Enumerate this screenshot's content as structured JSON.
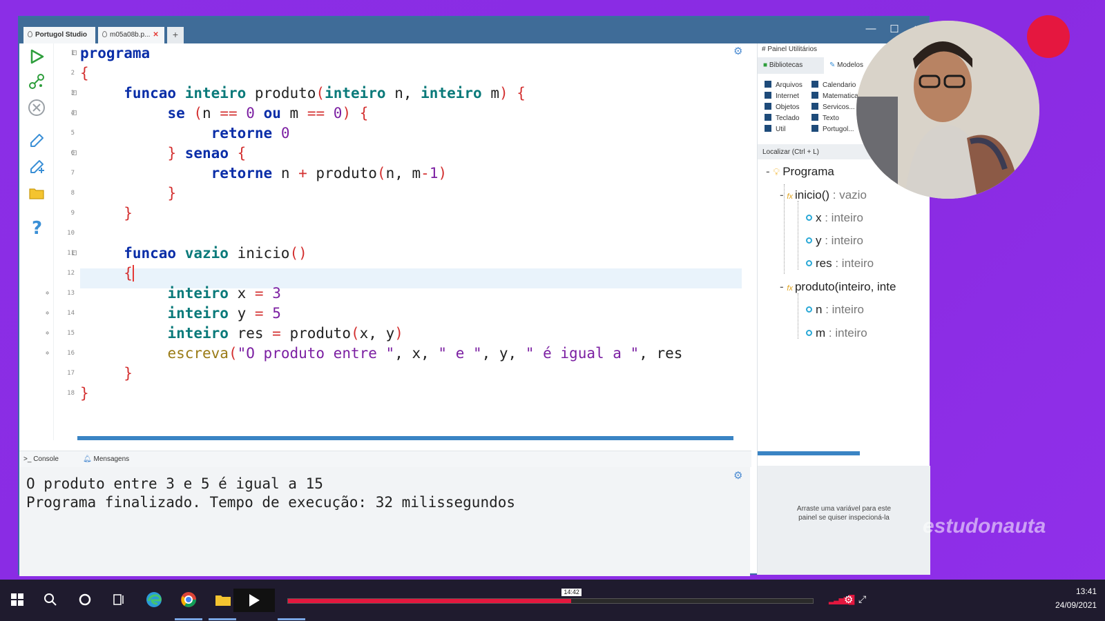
{
  "window": {
    "tabs": [
      {
        "label": "Portugol Studio"
      },
      {
        "label": "m05a08b.p..."
      }
    ],
    "add_tab": "+",
    "controls": {
      "minimize": "—",
      "maximize": "☐",
      "close": "✕"
    }
  },
  "editor": {
    "line_numbers": [
      "1",
      "2",
      "3",
      "4",
      "5",
      "6",
      "7",
      "8",
      "9",
      "10",
      "11",
      "12",
      "13",
      "14",
      "15",
      "16",
      "17",
      "18"
    ],
    "current_line": 12
  },
  "bottom": {
    "tabs": [
      {
        "label": "Console",
        "prefix": ">_"
      },
      {
        "label": "Mensagens"
      }
    ],
    "console_lines": [
      "O produto entre 3 e 5 é igual a 15",
      "Programa finalizado. Tempo de execução: 32 milissegundos"
    ]
  },
  "panel": {
    "title": "# Painel Utilitários",
    "tabs": [
      {
        "label": "Bibliotecas"
      },
      {
        "label": "Modelos"
      }
    ],
    "libraries_col1": [
      "Arquivos",
      "Internet",
      "Objetos",
      "Teclado",
      "Util"
    ],
    "libraries_col2": [
      "Calendario",
      "Matematica",
      "Servicos...",
      "Texto",
      "Portugol..."
    ],
    "search_label": "Localizar (Ctrl + L)",
    "tree": {
      "root": "Programa",
      "functions": [
        {
          "name": "inicio()",
          "type": ": vazio",
          "vars": [
            {
              "name": "x",
              "type": ": inteiro"
            },
            {
              "name": "y",
              "type": ": inteiro"
            },
            {
              "name": "res",
              "type": ": inteiro"
            }
          ]
        },
        {
          "name": "produto(inteiro, inte",
          "type": "",
          "vars": [
            {
              "name": "n",
              "type": ": inteiro"
            },
            {
              "name": "m",
              "type": ": inteiro"
            }
          ]
        }
      ]
    },
    "inspector_text_1": "Arraste uma variável para este",
    "inspector_text_2": "painel se quiser inspecioná-la"
  },
  "overlay": {
    "brand": "estudonauta"
  },
  "player": {
    "time_label": "14:42",
    "progress_fraction": 0.54
  },
  "taskbar": {
    "time": "13:41",
    "date": "24/09/2021"
  },
  "colors": {
    "background": "#8a2be2",
    "titlebar": "#3f6c98",
    "accent": "#3a84c4",
    "record": "#e5173f"
  }
}
